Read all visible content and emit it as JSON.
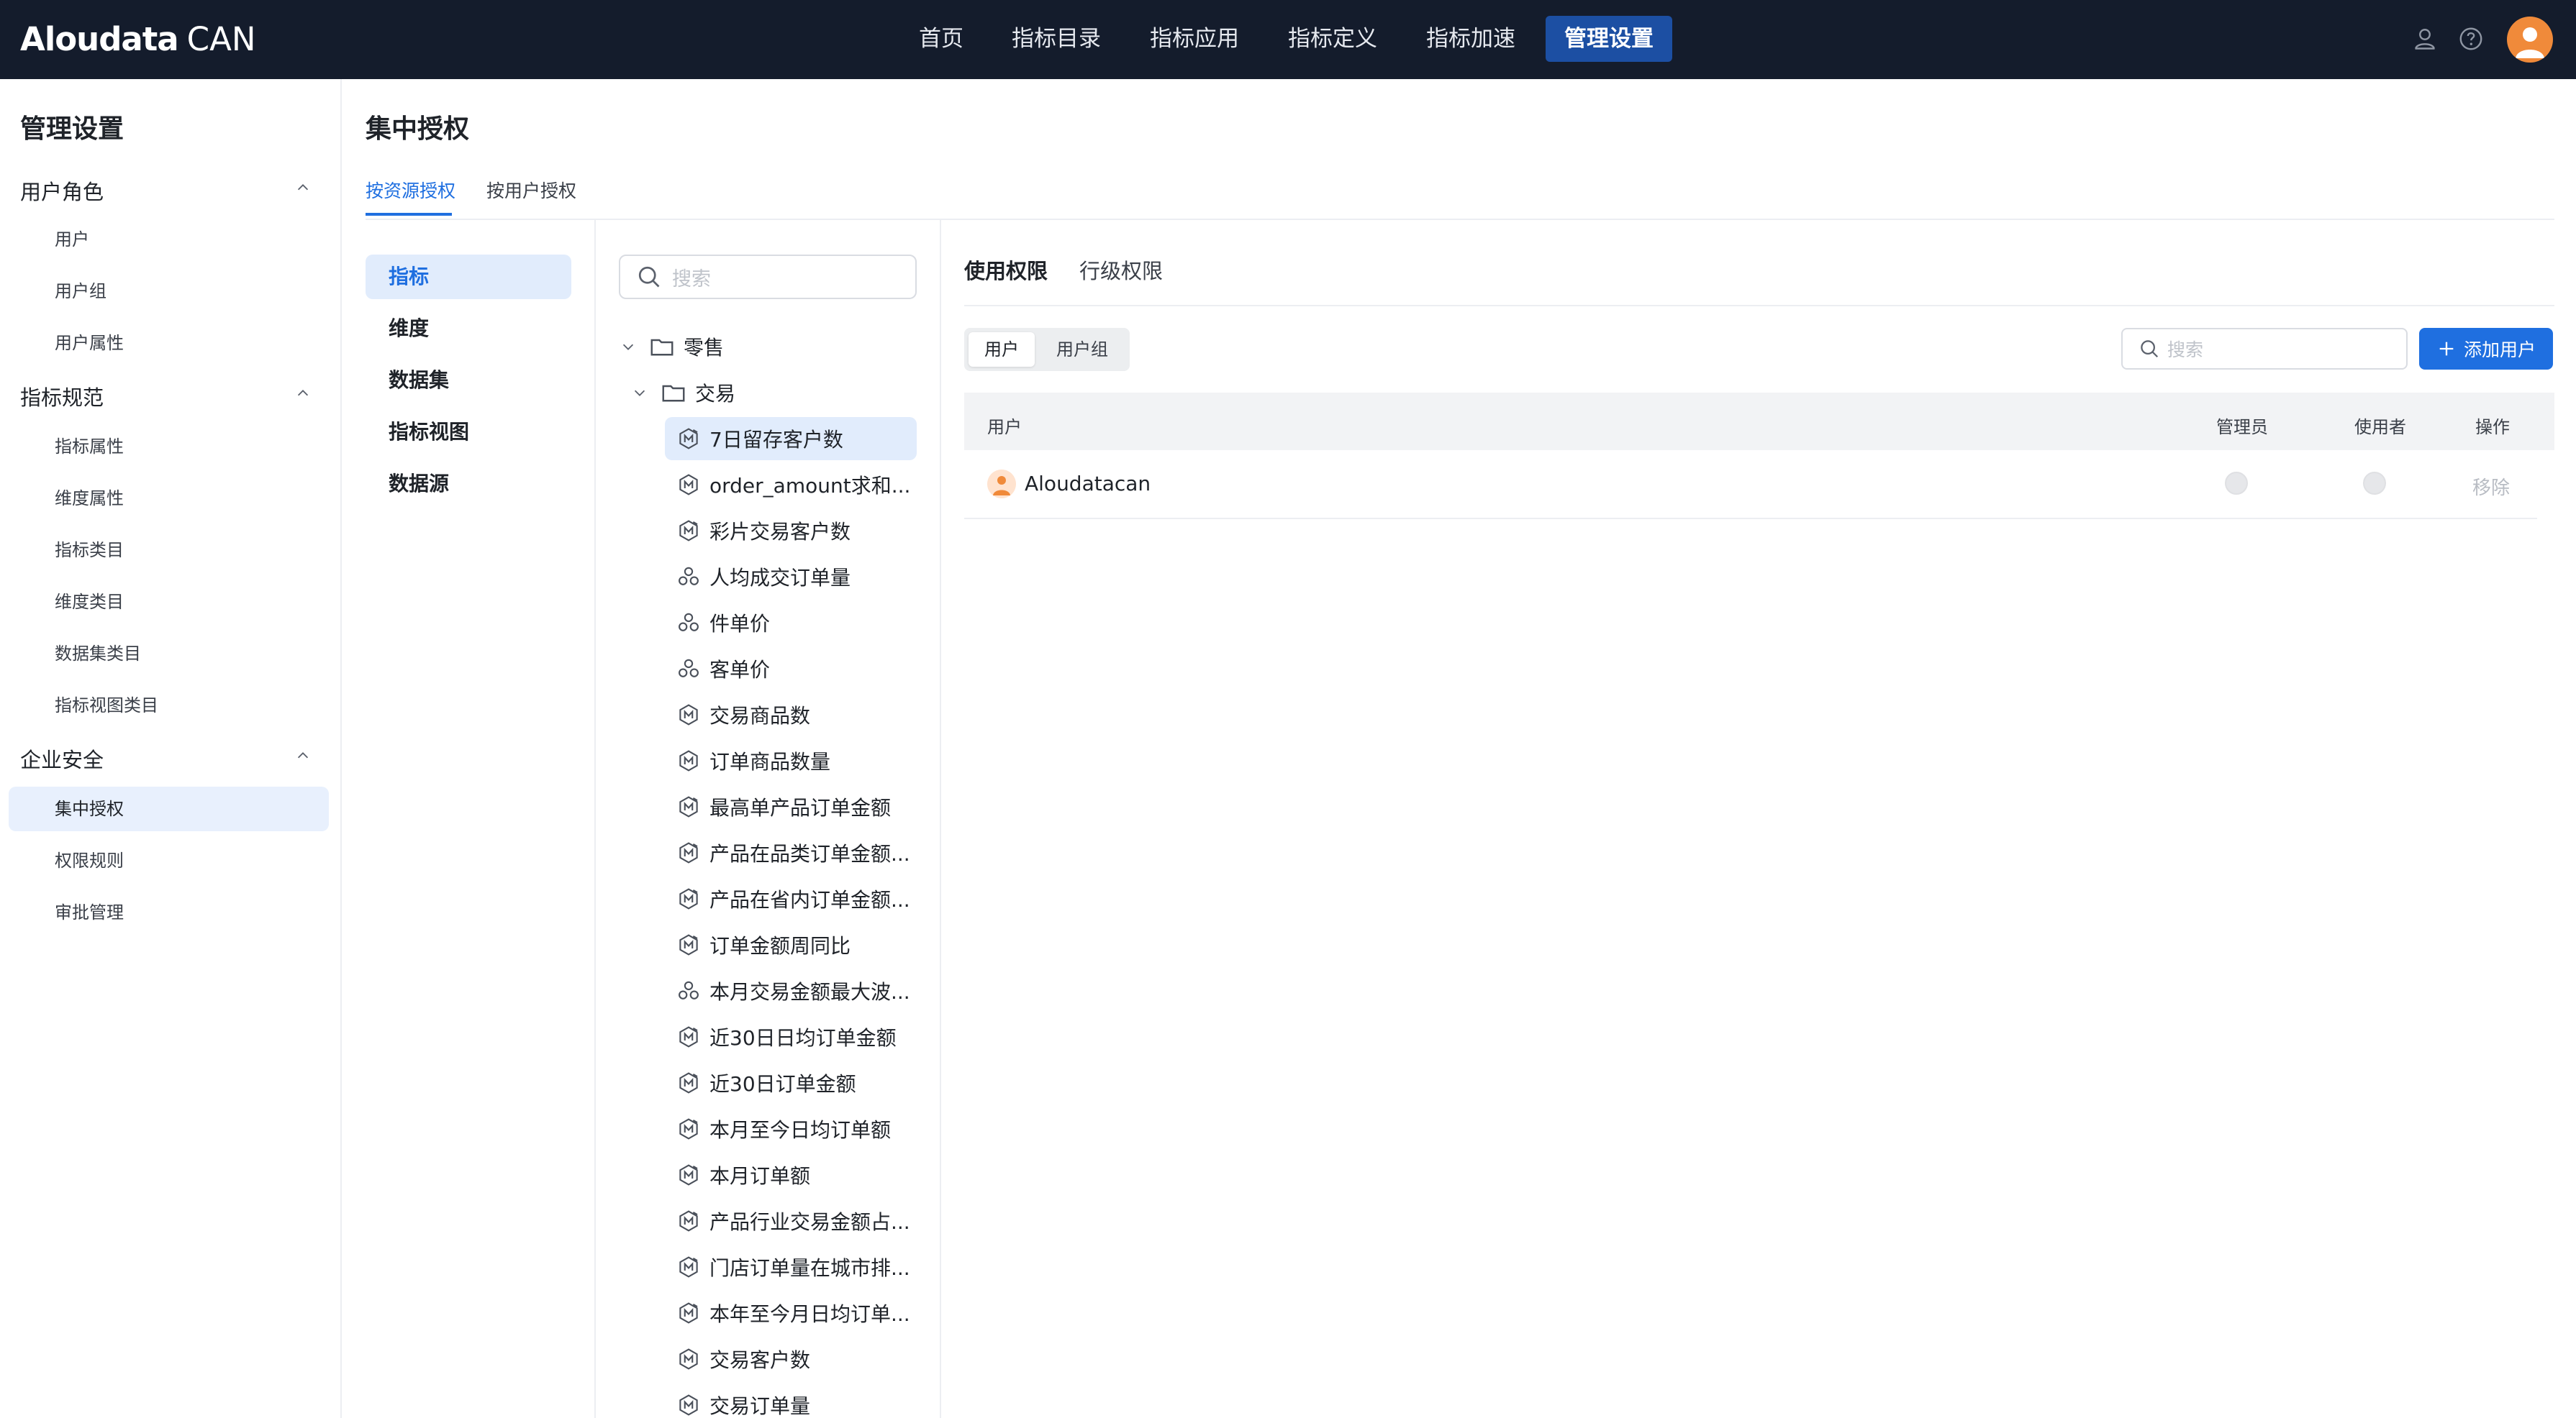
{
  "app": {
    "logo_main": "Aloudata",
    "logo_sub": "CAN"
  },
  "nav": {
    "items": [
      {
        "label": "首页",
        "active": false
      },
      {
        "label": "指标目录",
        "active": false
      },
      {
        "label": "指标应用",
        "active": false
      },
      {
        "label": "指标定义",
        "active": false
      },
      {
        "label": "指标加速",
        "active": false
      },
      {
        "label": "管理设置",
        "active": true
      }
    ],
    "icons": [
      "user-icon",
      "help-icon",
      "avatar"
    ]
  },
  "sidebar": {
    "title": "管理设置",
    "groups": [
      {
        "label": "用户角色",
        "expanded": true,
        "items": [
          "用户",
          "用户组",
          "用户属性"
        ]
      },
      {
        "label": "指标规范",
        "expanded": true,
        "items": [
          "指标属性",
          "维度属性",
          "指标类目",
          "维度类目",
          "数据集类目",
          "指标视图类目"
        ]
      },
      {
        "label": "企业安全",
        "expanded": true,
        "items": [
          "集中授权",
          "权限规则",
          "审批管理"
        ]
      }
    ],
    "active_item": "集中授权"
  },
  "page": {
    "title": "集中授权",
    "tabs": [
      {
        "label": "按资源授权",
        "active": true
      },
      {
        "label": "按用户授权",
        "active": false
      }
    ]
  },
  "resource_types": {
    "items": [
      "指标",
      "维度",
      "数据集",
      "指标视图",
      "数据源"
    ],
    "active": "指标"
  },
  "tree": {
    "search_placeholder": "搜索",
    "root_folder": "零售",
    "sub_folder": "交易",
    "items": [
      {
        "label": "7日留存客户数",
        "icon": "metric-derived-icon",
        "active": true
      },
      {
        "label": "order_amount求和...",
        "icon": "metric-atomic-icon"
      },
      {
        "label": "彩片交易客户数",
        "icon": "metric-derived-icon"
      },
      {
        "label": "人均成交订单量",
        "icon": "metric-composite-icon"
      },
      {
        "label": "件单价",
        "icon": "metric-composite-icon"
      },
      {
        "label": "客单价",
        "icon": "metric-composite-icon"
      },
      {
        "label": "交易商品数",
        "icon": "metric-atomic-icon"
      },
      {
        "label": "订单商品数量",
        "icon": "metric-atomic-icon"
      },
      {
        "label": "最高单产品订单金额",
        "icon": "metric-derived-icon"
      },
      {
        "label": "产品在品类订单金额...",
        "icon": "metric-derived-icon"
      },
      {
        "label": "产品在省内订单金额...",
        "icon": "metric-derived-icon"
      },
      {
        "label": "订单金额周同比",
        "icon": "metric-derived-icon"
      },
      {
        "label": "本月交易金额最大波...",
        "icon": "metric-composite-icon"
      },
      {
        "label": "近30日日均订单金额",
        "icon": "metric-derived-icon"
      },
      {
        "label": "近30日订单金额",
        "icon": "metric-derived-icon"
      },
      {
        "label": "本月至今日均订单额",
        "icon": "metric-derived-icon"
      },
      {
        "label": "本月订单额",
        "icon": "metric-derived-icon"
      },
      {
        "label": "产品行业交易金额占...",
        "icon": "metric-derived-icon"
      },
      {
        "label": "门店订单量在城市排...",
        "icon": "metric-derived-icon"
      },
      {
        "label": "本年至今月日均订单...",
        "icon": "metric-derived-icon"
      },
      {
        "label": "交易客户数",
        "icon": "metric-atomic-icon"
      },
      {
        "label": "交易订单量",
        "icon": "metric-atomic-icon"
      }
    ]
  },
  "permissions": {
    "tabs": [
      {
        "label": "使用权限",
        "active": true
      },
      {
        "label": "行级权限",
        "active": false
      }
    ],
    "segment": [
      {
        "label": "用户",
        "active": true
      },
      {
        "label": "用户组",
        "active": false
      }
    ],
    "search_placeholder": "搜索",
    "add_button": "添加用户",
    "columns": [
      "用户",
      "管理员",
      "使用者",
      "操作"
    ],
    "rows": [
      {
        "name": "Aloudatacan",
        "admin": false,
        "user": false,
        "action": "移除"
      }
    ]
  },
  "colors": {
    "topbar_bg": "#141c2c",
    "nav_active_bg": "#1c4fa3",
    "accent": "#1f6fe0",
    "selected_bg": "#e1ecfc",
    "avatar": "#f08a3a"
  }
}
